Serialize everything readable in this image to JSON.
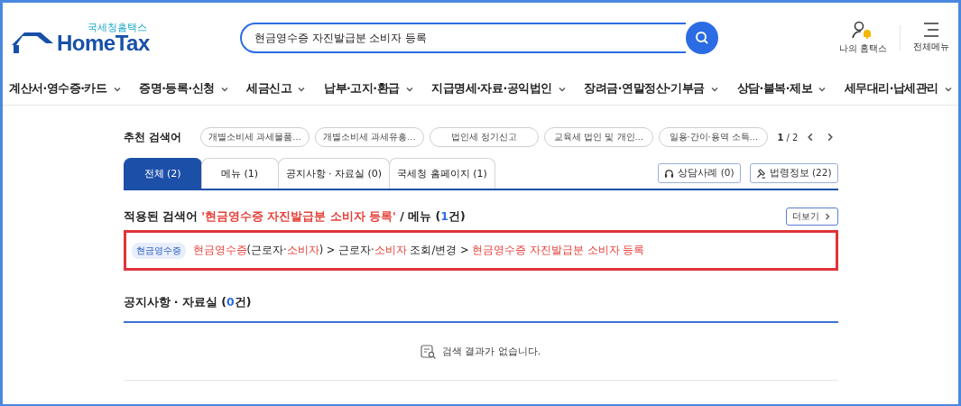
{
  "logo": {
    "subtitle": "국세청홈택스",
    "name": "HomeTax"
  },
  "search": {
    "value": "현금영수증 자진발급분 소비자 등록"
  },
  "utility": [
    {
      "kind": "my",
      "label": "나의 홈택스"
    },
    {
      "kind": "menu",
      "label": "전체메뉴"
    }
  ],
  "nav": [
    {
      "label": "계산서·영수증·카드"
    },
    {
      "label": "증명·등록·신청"
    },
    {
      "label": "세금신고"
    },
    {
      "label": "납부·고지·환급"
    },
    {
      "label": "지급명세·자료·공익법인"
    },
    {
      "label": "장려금·연말정산·기부금"
    },
    {
      "label": "상담·불복·제보"
    },
    {
      "label": "세무대리·납세관리"
    }
  ],
  "recommended": {
    "label": "추천 검색어",
    "chips": [
      "개별소비세 과세물품…",
      "개별소비세 과세유흥…",
      "법인세 정기신고",
      "교육세 법인 및 개인…",
      "일용·간이·용역 소득…"
    ],
    "page": "1",
    "pages": "/ 2"
  },
  "tabs": [
    {
      "label": "전체 (2)",
      "selected": true
    },
    {
      "label": "메뉴 (1)",
      "selected": false
    },
    {
      "label": "공지사항 · 자료실 (0)",
      "selected": false
    },
    {
      "label": "국세청 홈페이지 (1)",
      "selected": false
    }
  ],
  "side_buttons": [
    {
      "kind": "headset",
      "label": "상담사례 (0)"
    },
    {
      "kind": "gavel",
      "label": "법령정보 (22)"
    }
  ],
  "menu_section": {
    "heading": {
      "label": "적용된 검색어",
      "query": "'현금영수증 자진발급분 소비자 등록'",
      "scope": "/ 메뉴 (",
      "count": "1",
      "unit": "건)"
    },
    "more": "더보기",
    "results": [
      {
        "tag": "현금영수증",
        "highlighted": true,
        "path": [
          {
            "text": "현금영수증",
            "match": true
          },
          {
            "text": "(근로자·",
            "match": false
          },
          {
            "text": "소비자",
            "match": true
          },
          {
            "text": ") > 근로자·",
            "match": false
          },
          {
            "text": "소비자",
            "match": true
          },
          {
            "text": " 조회/변경 > ",
            "match": false
          },
          {
            "text": "현금영수증 자진발급분 소비자 등록",
            "match": true
          }
        ]
      }
    ]
  },
  "notice_section": {
    "heading": {
      "scope": "공지사항 · 자료실 (",
      "count": "0",
      "unit": "건)"
    },
    "empty": "검색 결과가 없습니다."
  }
}
